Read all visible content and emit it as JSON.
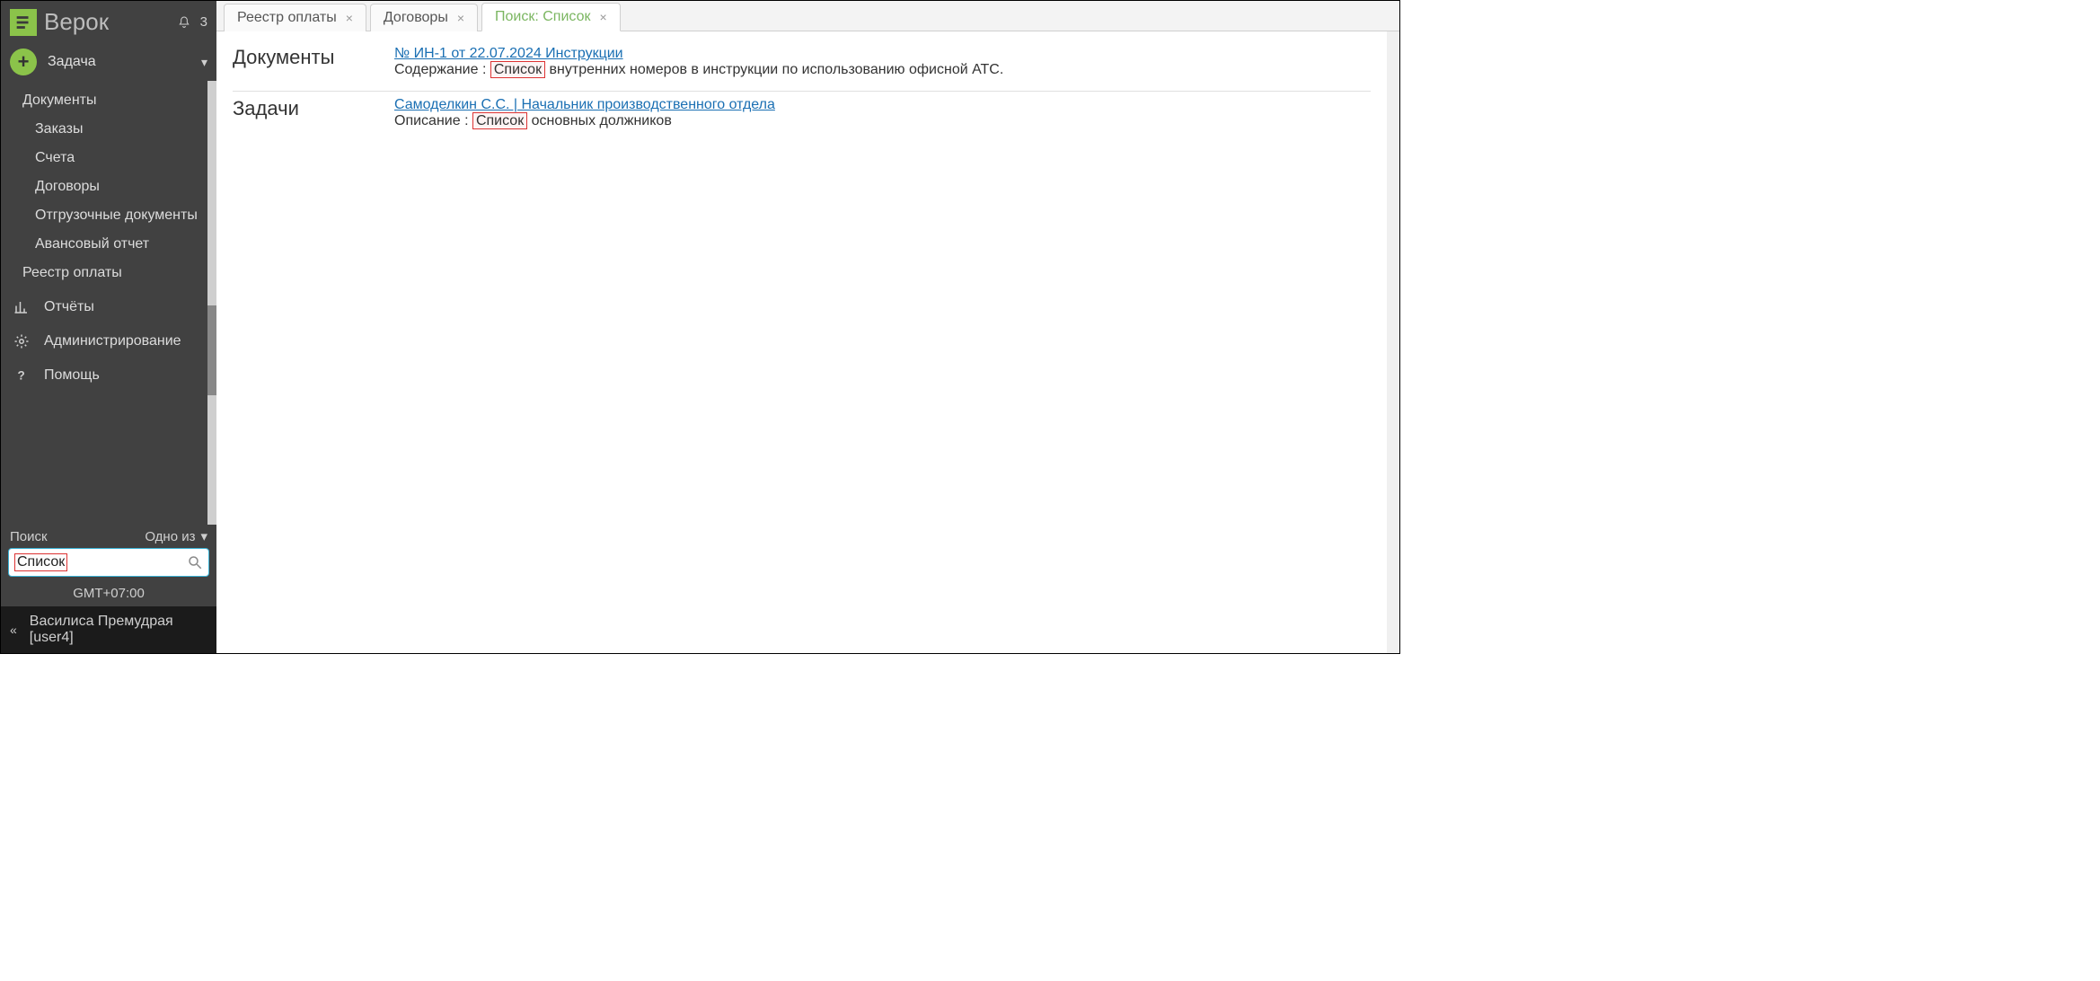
{
  "brand": {
    "name": "Верок"
  },
  "notifications": {
    "count": "3"
  },
  "task_dropdown": {
    "label": "Задача"
  },
  "sidebar": {
    "items": {
      "documents": "Документы",
      "orders": "Заказы",
      "invoices": "Счета",
      "contracts": "Договоры",
      "shipping": "Отгрузочные документы",
      "advance": "Авансовый отчет",
      "payment_registry": "Реестр оплаты",
      "reports": "Отчёты",
      "admin": "Администрирование",
      "help": "Помощь"
    }
  },
  "search": {
    "label": "Поиск",
    "mode": "Одно из",
    "value": "Список"
  },
  "timezone": "GMT+07:00",
  "user": {
    "display": "Василиса Премудрая [user4]"
  },
  "tabs": [
    {
      "label": "Реестр оплаты",
      "active": false
    },
    {
      "label": "Договоры",
      "active": false
    },
    {
      "label": "Поиск: Список",
      "active": true
    }
  ],
  "results": {
    "documents": {
      "heading": "Документы",
      "link": "№ ИН-1 от 22.07.2024 Инструкции",
      "desc_prefix": "Содержание : ",
      "highlight": "Список",
      "desc_suffix": " внутренних номеров в инструкции по использованию офисной АТС."
    },
    "tasks": {
      "heading": "Задачи",
      "link": "Самоделкин С.С.  |  Начальник производственного отдела",
      "desc_prefix": "Описание : ",
      "highlight": "Список",
      "desc_suffix": " основных должников"
    }
  }
}
